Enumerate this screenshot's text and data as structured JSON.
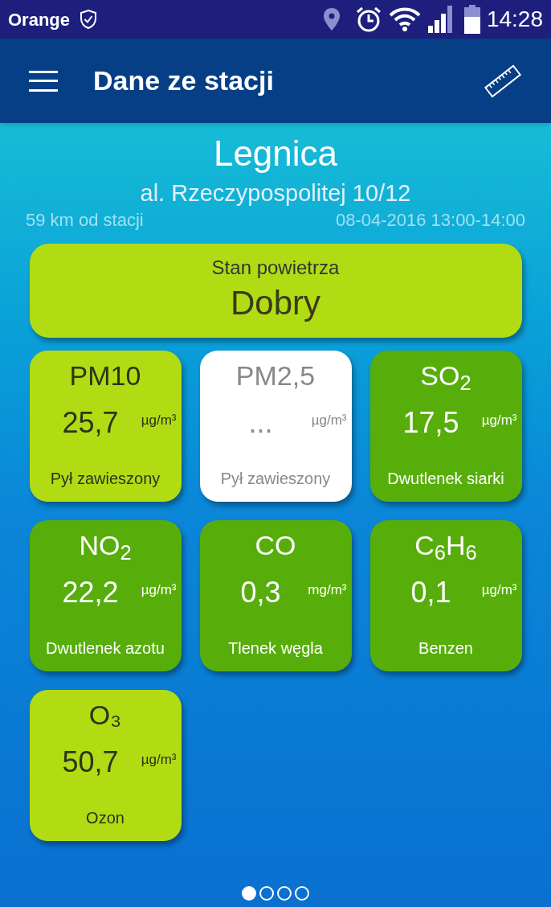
{
  "status_bar": {
    "carrier": "Orange",
    "time": "14:28"
  },
  "app_bar": {
    "title": "Dane ze stacji"
  },
  "station": {
    "city": "Legnica",
    "address": "al. Rzeczypospolitej 10/12",
    "distance": "59 km od stacji",
    "period": "08-04-2016 13:00-14:00"
  },
  "air_quality": {
    "label": "Stan powietrza",
    "value": "Dobry",
    "kind": "good"
  },
  "pollutants": [
    {
      "symbol": "PM10",
      "value": "25,7",
      "unit": "µg/m³",
      "name": "Pył zawieszony",
      "kind": "good"
    },
    {
      "symbol": "PM2,5",
      "value": "...",
      "unit": "µg/m³",
      "name": "Pył zawieszony",
      "kind": "none"
    },
    {
      "symbol": "SO$_{2}$",
      "value": "17,5",
      "unit": "µg/m³",
      "name": "Dwutlenek siarki",
      "kind": "very_good"
    },
    {
      "symbol": "NO$_{2}$",
      "value": "22,2",
      "unit": "µg/m³",
      "name": "Dwutlenek azotu",
      "kind": "very_good"
    },
    {
      "symbol": "CO",
      "value": "0,3",
      "unit": "mg/m³",
      "name": "Tlenek węgla",
      "kind": "very_good"
    },
    {
      "symbol": "C$_{6}$H$_{6}$",
      "value": "0,1",
      "unit": "µg/m³",
      "name": "Benzen",
      "kind": "very_good"
    },
    {
      "symbol": "O₃",
      "value": "50,7",
      "unit": "µg/m³",
      "name": "Ozon",
      "kind": "good"
    }
  ],
  "pager": [
    {
      "selected": true
    },
    {
      "selected": false
    },
    {
      "selected": false
    },
    {
      "selected": false
    }
  ]
}
